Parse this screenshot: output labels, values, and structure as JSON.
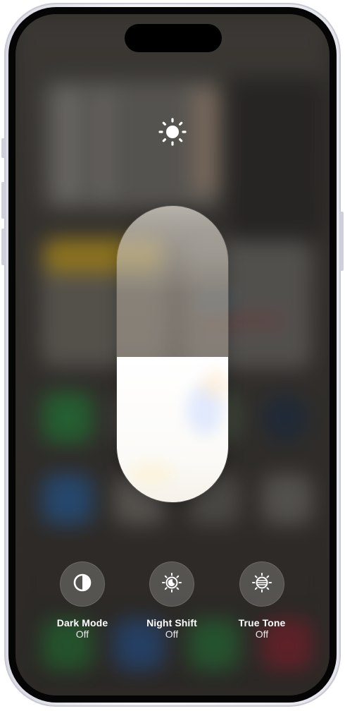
{
  "panel": {
    "header_icon": "sun-brightness-icon",
    "brightness_fraction": 0.49
  },
  "controls": [
    {
      "icon": "dark-mode-icon",
      "label": "Dark Mode",
      "state": "Off"
    },
    {
      "icon": "night-shift-icon",
      "label": "Night Shift",
      "state": "Off"
    },
    {
      "icon": "true-tone-icon",
      "label": "True Tone",
      "state": "Off"
    }
  ],
  "colors": {
    "slider_fill": "#ffffff",
    "control_button": "#78767499"
  }
}
